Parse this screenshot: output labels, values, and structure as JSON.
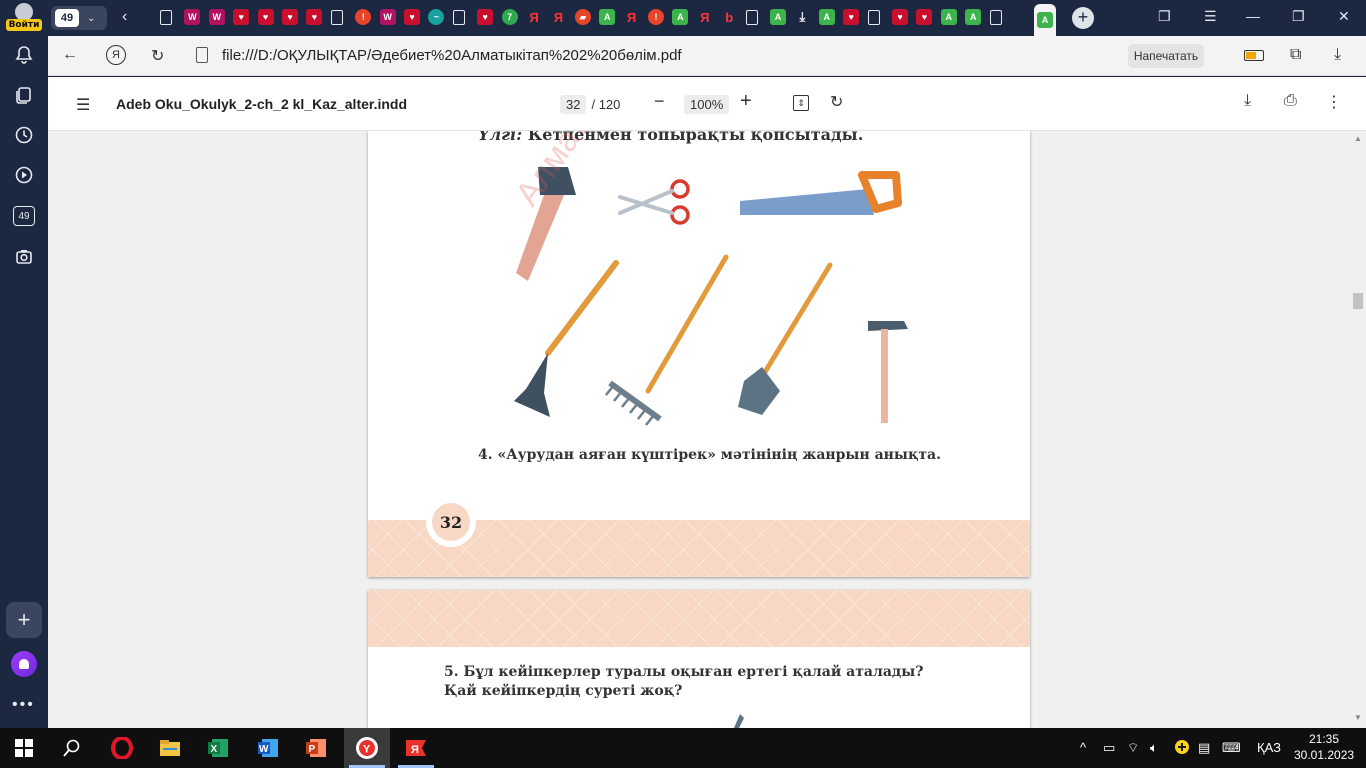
{
  "sidebar": {
    "login_label": "Войти",
    "tabs_badge": "49"
  },
  "tab_strip": {
    "tab_count": "49",
    "favicons": [
      "doc",
      "magenta",
      "magenta",
      "red",
      "red",
      "red",
      "red",
      "doc",
      "orange",
      "magenta",
      "red",
      "teal",
      "doc",
      "red",
      "green",
      "ya",
      "ya",
      "img",
      "lime",
      "ya",
      "orange",
      "lime",
      "ya",
      "b",
      "doc",
      "lime",
      "download",
      "lime",
      "red",
      "doc",
      "red",
      "red",
      "lime",
      "lime",
      "doc"
    ],
    "active_tab_icon": "lime"
  },
  "address_bar": {
    "url": "file:///D:/ОҚУЛЫҚТАР/Әдебиет%20Алматыкітап%202%20бөлім.pdf",
    "print_label": "Напечатать",
    "ya_icon": "Я"
  },
  "pdf_toolbar": {
    "title": "Adeb Oku_Okulyk_2-ch_2 kl_Kaz_alter.indd",
    "current_page": "32",
    "total_pages": "/ 120",
    "zoom": "100%"
  },
  "page_a": {
    "sample_prefix": "Үлгі:",
    "sample_text": "Кетпенмен топырақты қопсытады.",
    "watermark": "Алматыкітап",
    "task4": "4. «Аурудан аяған күштірек» мәтінінің жанрын анықта.",
    "page_number": "32"
  },
  "page_b": {
    "task5_line1": "5. Бұл кейіпкерлер туралы оқыған ертегі қалай аталады?",
    "task5_line2": "Қай кейіпкердің суреті жоқ?"
  },
  "taskbar": {
    "lang": "ҚАЗ",
    "time": "21:35",
    "date": "30.01.2023"
  },
  "colors": {
    "sidebar_bg": "#1c2742",
    "page_band": "#f8d8c4",
    "login_badge": "#f5c518",
    "tool_handle": "#e39a3b"
  }
}
